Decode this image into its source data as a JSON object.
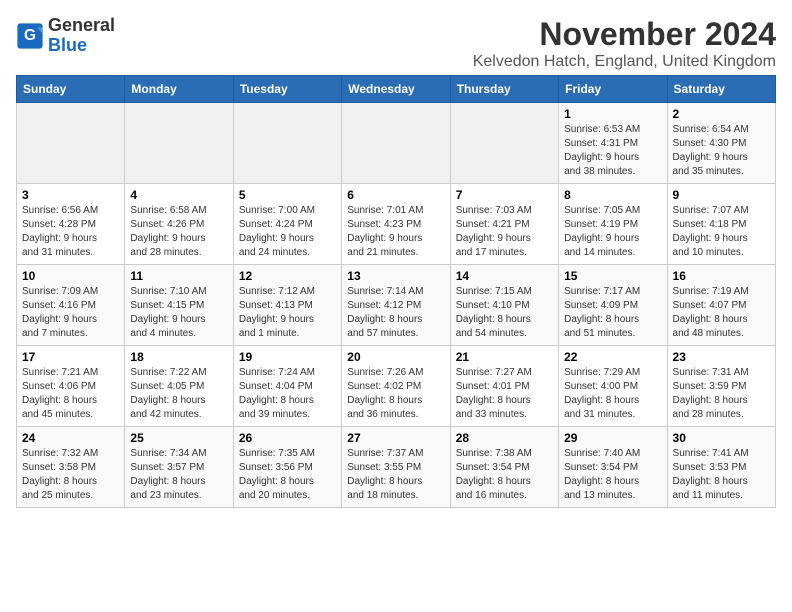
{
  "logo": {
    "general": "General",
    "blue": "Blue"
  },
  "header": {
    "month_title": "November 2024",
    "location": "Kelvedon Hatch, England, United Kingdom"
  },
  "weekdays": [
    "Sunday",
    "Monday",
    "Tuesday",
    "Wednesday",
    "Thursday",
    "Friday",
    "Saturday"
  ],
  "weeks": [
    [
      {
        "day": "",
        "info": ""
      },
      {
        "day": "",
        "info": ""
      },
      {
        "day": "",
        "info": ""
      },
      {
        "day": "",
        "info": ""
      },
      {
        "day": "",
        "info": ""
      },
      {
        "day": "1",
        "info": "Sunrise: 6:53 AM\nSunset: 4:31 PM\nDaylight: 9 hours\nand 38 minutes."
      },
      {
        "day": "2",
        "info": "Sunrise: 6:54 AM\nSunset: 4:30 PM\nDaylight: 9 hours\nand 35 minutes."
      }
    ],
    [
      {
        "day": "3",
        "info": "Sunrise: 6:56 AM\nSunset: 4:28 PM\nDaylight: 9 hours\nand 31 minutes."
      },
      {
        "day": "4",
        "info": "Sunrise: 6:58 AM\nSunset: 4:26 PM\nDaylight: 9 hours\nand 28 minutes."
      },
      {
        "day": "5",
        "info": "Sunrise: 7:00 AM\nSunset: 4:24 PM\nDaylight: 9 hours\nand 24 minutes."
      },
      {
        "day": "6",
        "info": "Sunrise: 7:01 AM\nSunset: 4:23 PM\nDaylight: 9 hours\nand 21 minutes."
      },
      {
        "day": "7",
        "info": "Sunrise: 7:03 AM\nSunset: 4:21 PM\nDaylight: 9 hours\nand 17 minutes."
      },
      {
        "day": "8",
        "info": "Sunrise: 7:05 AM\nSunset: 4:19 PM\nDaylight: 9 hours\nand 14 minutes."
      },
      {
        "day": "9",
        "info": "Sunrise: 7:07 AM\nSunset: 4:18 PM\nDaylight: 9 hours\nand 10 minutes."
      }
    ],
    [
      {
        "day": "10",
        "info": "Sunrise: 7:09 AM\nSunset: 4:16 PM\nDaylight: 9 hours\nand 7 minutes."
      },
      {
        "day": "11",
        "info": "Sunrise: 7:10 AM\nSunset: 4:15 PM\nDaylight: 9 hours\nand 4 minutes."
      },
      {
        "day": "12",
        "info": "Sunrise: 7:12 AM\nSunset: 4:13 PM\nDaylight: 9 hours\nand 1 minute."
      },
      {
        "day": "13",
        "info": "Sunrise: 7:14 AM\nSunset: 4:12 PM\nDaylight: 8 hours\nand 57 minutes."
      },
      {
        "day": "14",
        "info": "Sunrise: 7:15 AM\nSunset: 4:10 PM\nDaylight: 8 hours\nand 54 minutes."
      },
      {
        "day": "15",
        "info": "Sunrise: 7:17 AM\nSunset: 4:09 PM\nDaylight: 8 hours\nand 51 minutes."
      },
      {
        "day": "16",
        "info": "Sunrise: 7:19 AM\nSunset: 4:07 PM\nDaylight: 8 hours\nand 48 minutes."
      }
    ],
    [
      {
        "day": "17",
        "info": "Sunrise: 7:21 AM\nSunset: 4:06 PM\nDaylight: 8 hours\nand 45 minutes."
      },
      {
        "day": "18",
        "info": "Sunrise: 7:22 AM\nSunset: 4:05 PM\nDaylight: 8 hours\nand 42 minutes."
      },
      {
        "day": "19",
        "info": "Sunrise: 7:24 AM\nSunset: 4:04 PM\nDaylight: 8 hours\nand 39 minutes."
      },
      {
        "day": "20",
        "info": "Sunrise: 7:26 AM\nSunset: 4:02 PM\nDaylight: 8 hours\nand 36 minutes."
      },
      {
        "day": "21",
        "info": "Sunrise: 7:27 AM\nSunset: 4:01 PM\nDaylight: 8 hours\nand 33 minutes."
      },
      {
        "day": "22",
        "info": "Sunrise: 7:29 AM\nSunset: 4:00 PM\nDaylight: 8 hours\nand 31 minutes."
      },
      {
        "day": "23",
        "info": "Sunrise: 7:31 AM\nSunset: 3:59 PM\nDaylight: 8 hours\nand 28 minutes."
      }
    ],
    [
      {
        "day": "24",
        "info": "Sunrise: 7:32 AM\nSunset: 3:58 PM\nDaylight: 8 hours\nand 25 minutes."
      },
      {
        "day": "25",
        "info": "Sunrise: 7:34 AM\nSunset: 3:57 PM\nDaylight: 8 hours\nand 23 minutes."
      },
      {
        "day": "26",
        "info": "Sunrise: 7:35 AM\nSunset: 3:56 PM\nDaylight: 8 hours\nand 20 minutes."
      },
      {
        "day": "27",
        "info": "Sunrise: 7:37 AM\nSunset: 3:55 PM\nDaylight: 8 hours\nand 18 minutes."
      },
      {
        "day": "28",
        "info": "Sunrise: 7:38 AM\nSunset: 3:54 PM\nDaylight: 8 hours\nand 16 minutes."
      },
      {
        "day": "29",
        "info": "Sunrise: 7:40 AM\nSunset: 3:54 PM\nDaylight: 8 hours\nand 13 minutes."
      },
      {
        "day": "30",
        "info": "Sunrise: 7:41 AM\nSunset: 3:53 PM\nDaylight: 8 hours\nand 11 minutes."
      }
    ]
  ]
}
